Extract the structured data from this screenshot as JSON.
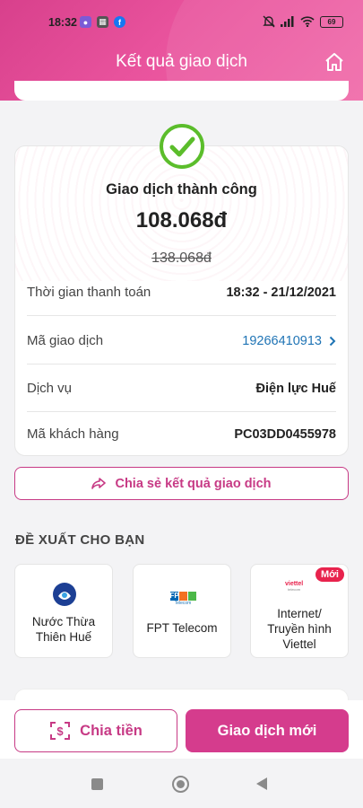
{
  "status_bar": {
    "time": "18:32",
    "battery": "69"
  },
  "header": {
    "title": "Kết quả giao dịch"
  },
  "result": {
    "status": "Giao dịch thành công",
    "amount": "108.068đ",
    "original_amount": "138.068đ",
    "rows": [
      {
        "label": "Thời gian thanh toán",
        "value": "18:32 - 21/12/2021"
      },
      {
        "label": "Mã giao dịch",
        "value": "19266410913"
      },
      {
        "label": "Dịch vụ",
        "value": "Điện lực Huế"
      },
      {
        "label": "Mã khách hàng",
        "value": "PC03DD0455978"
      }
    ]
  },
  "share_label": "Chia sẻ kết quả giao dịch",
  "suggest": {
    "title": "ĐỀ XUẤT CHO BẠN",
    "items": [
      {
        "name_lines": [
          "Nước Thừa",
          "Thiên Huế"
        ]
      },
      {
        "name_lines": [
          "FPT Telecom"
        ],
        "logo_text": "FPT",
        "logo_sub": "Telecom"
      },
      {
        "name_lines": [
          "Internet/",
          "Truyền hình",
          "Viettel"
        ],
        "badge": "Mới",
        "logo_text": "viettel",
        "logo_sub": "telecom"
      }
    ]
  },
  "actions": {
    "split": "Chia tiền",
    "new": "Giao dịch mới"
  },
  "colors": {
    "brand": "#d53c8d",
    "success": "#5bbd2b",
    "link": "#1f74b5"
  }
}
